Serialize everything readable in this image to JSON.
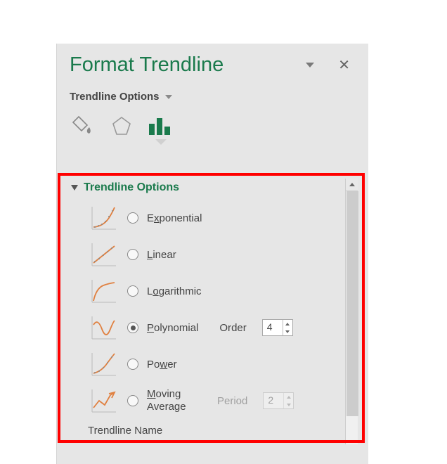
{
  "panel": {
    "title": "Format Trendline",
    "subtitle": "Trendline Options"
  },
  "section": {
    "title": "Trendline Options",
    "options": [
      {
        "label_pre": "E",
        "label_ul": "x",
        "label_post": "ponential",
        "selected": false
      },
      {
        "label_pre": "",
        "label_ul": "L",
        "label_post": "inear",
        "selected": false
      },
      {
        "label_pre": "L",
        "label_ul": "o",
        "label_post": "garithmic",
        "selected": false
      },
      {
        "label_pre": "",
        "label_ul": "P",
        "label_post": "olynomial",
        "selected": true,
        "param_label_pre": "Or",
        "param_label_ul": "d",
        "param_label_post": "er",
        "param_value": "4",
        "param_enabled": true
      },
      {
        "label_pre": "Po",
        "label_ul": "w",
        "label_post": "er",
        "selected": false
      },
      {
        "label_pre": "",
        "label_ul": "M",
        "label_post": "oving Average",
        "multiline": true,
        "selected": false,
        "param_label_pre": "P",
        "param_label_ul": "e",
        "param_label_post": "riod",
        "param_value": "2",
        "param_enabled": false
      }
    ]
  },
  "footer": {
    "trendline_name_label": "Trendline Name"
  }
}
